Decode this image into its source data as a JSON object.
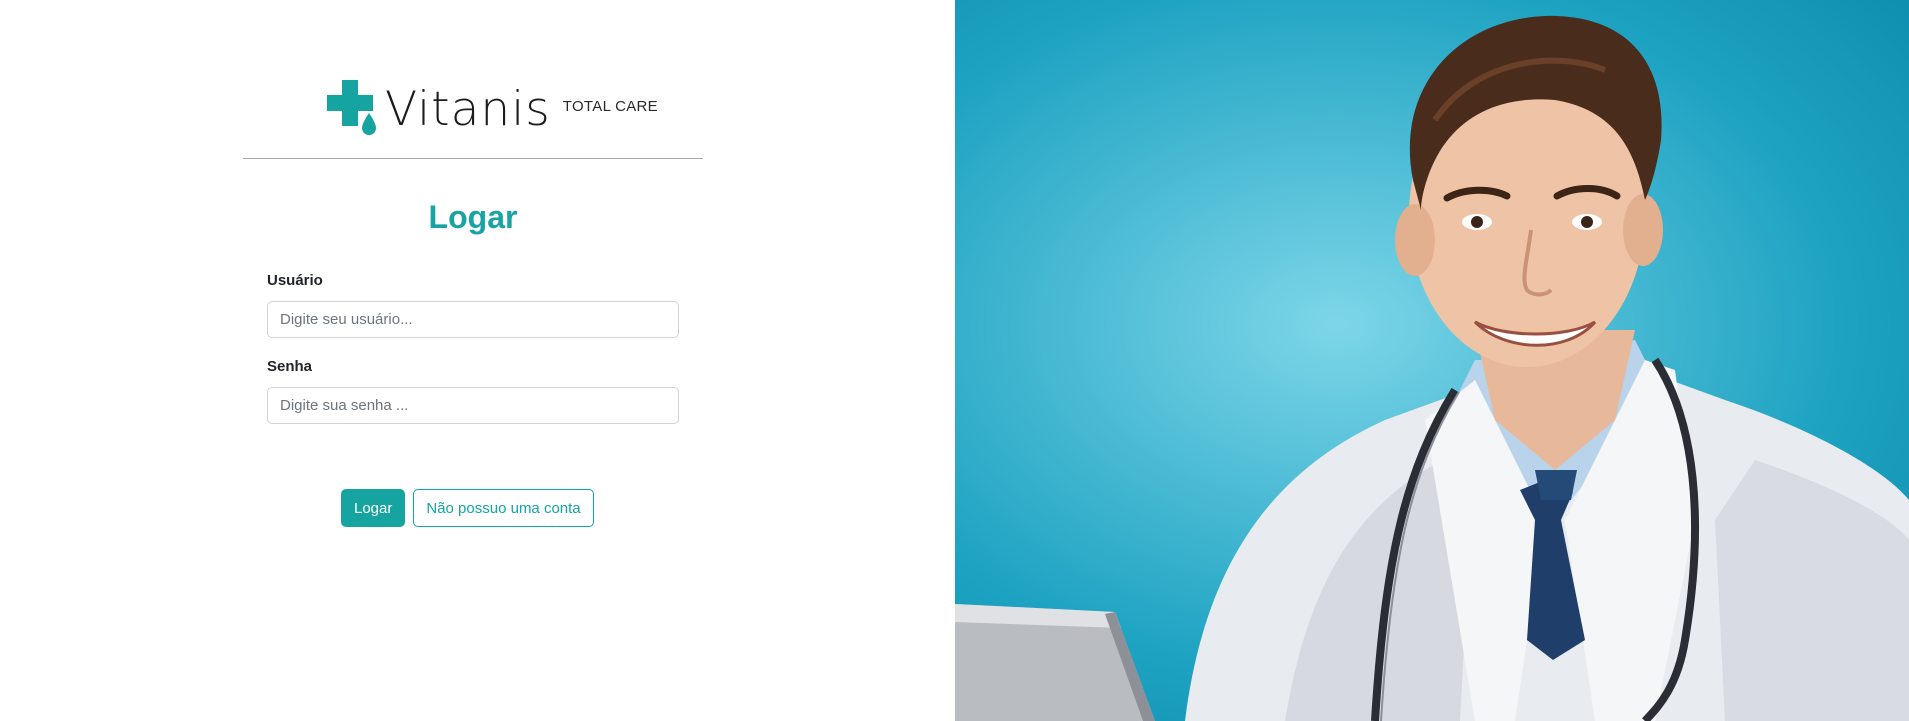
{
  "brand": {
    "name": "Vitanis",
    "tagline": "TOTAL CARE",
    "accent_color": "#16a4a0",
    "logo_icon": "medical-cross-drop-icon"
  },
  "login": {
    "title": "Logar",
    "username": {
      "label": "Usuário",
      "placeholder": "Digite seu usuário...",
      "value": ""
    },
    "password": {
      "label": "Senha",
      "placeholder": "Digite sua senha ...",
      "value": ""
    },
    "submit_label": "Logar",
    "no_account_label": "Não possuo uma conta"
  },
  "hero": {
    "image": "smiling-doctor-with-stethoscope-photo",
    "background_color": "#1ea3c2"
  }
}
